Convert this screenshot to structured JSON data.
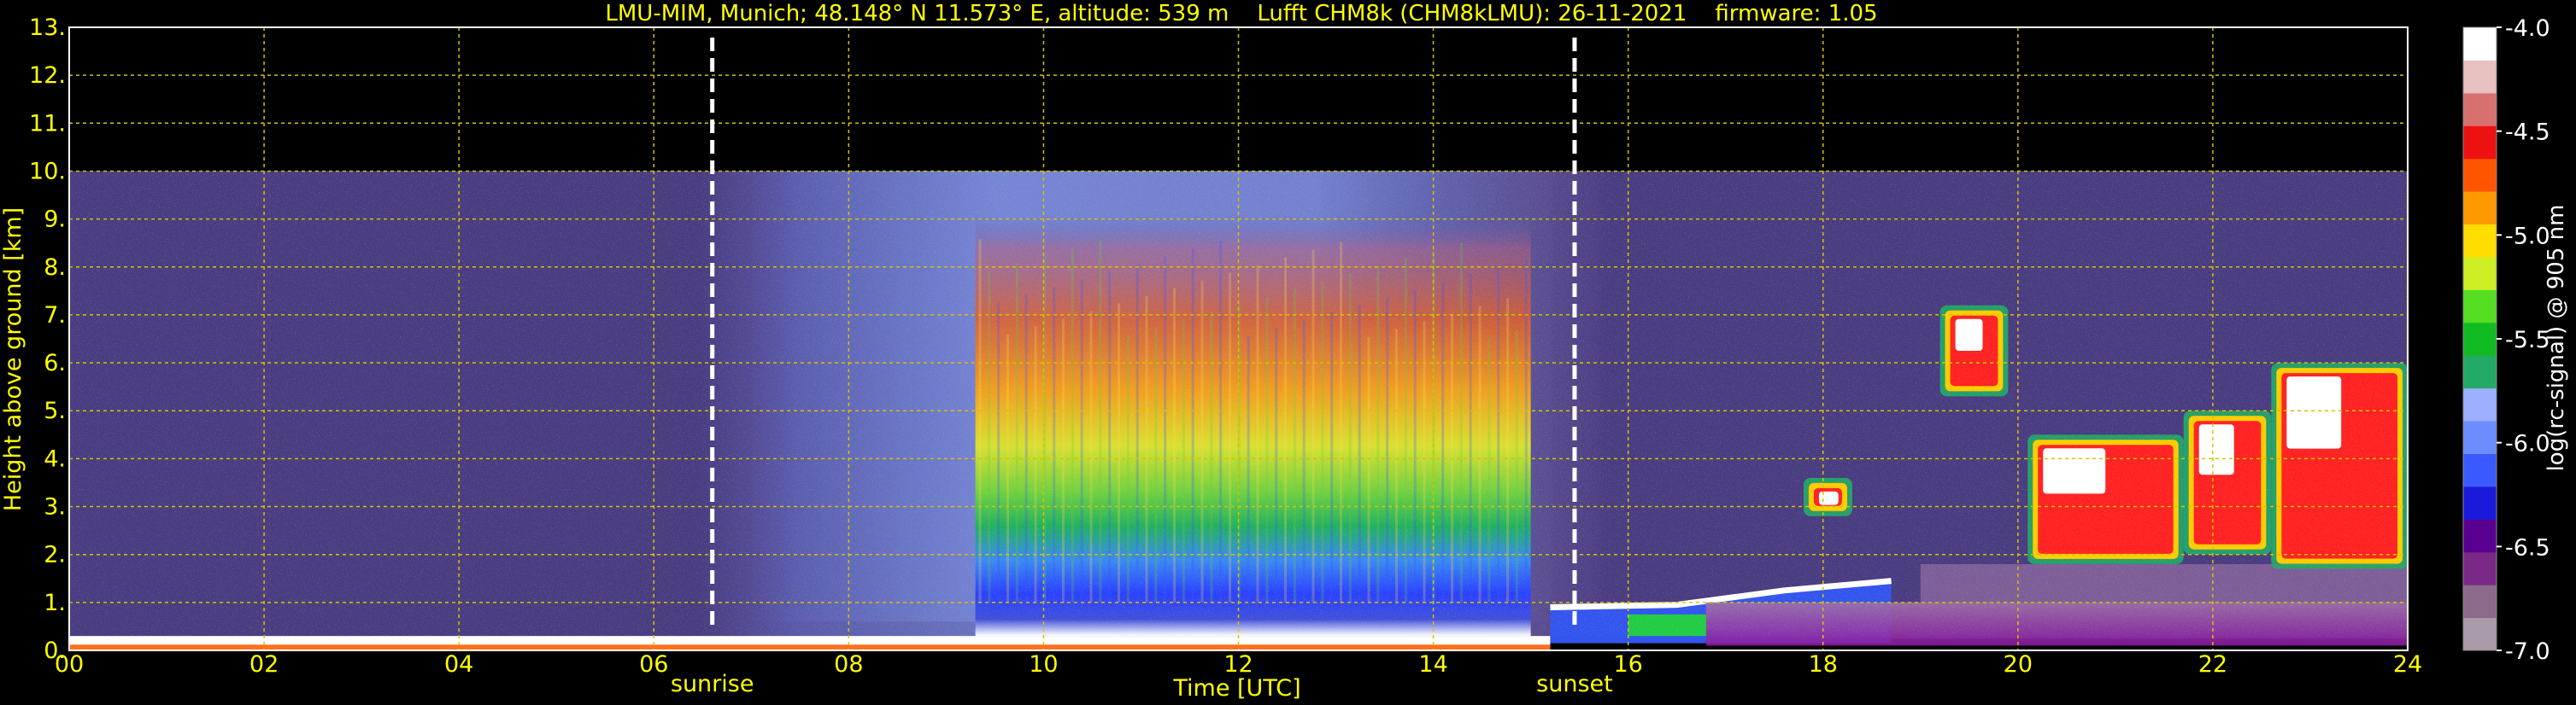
{
  "chart_data": {
    "type": "heatmap",
    "title": "LMU-MIM, Munich; 48.148° N 11.573° E, altitude: 539 m    Lufft CHM8k (CHM8kLMU): 26-11-2021    firmware: 1.05",
    "xlabel": "Time [UTC]",
    "ylabel": "Height above ground [km]",
    "colorbar_label": "log(rc-signal) @ 905 nm",
    "xlim": [
      0,
      24
    ],
    "ylim": [
      0,
      13
    ],
    "x_ticks": [
      "00",
      "02",
      "04",
      "06",
      "08",
      "10",
      "12",
      "14",
      "16",
      "18",
      "20",
      "22",
      "24"
    ],
    "y_ticks": [
      "0.",
      "1.",
      "2.",
      "3.",
      "4.",
      "5.",
      "6.",
      "7.",
      "8.",
      "9.",
      "10.",
      "11.",
      "12.",
      "13."
    ],
    "colorbar_range": [
      -7.0,
      -4.0
    ],
    "colorbar_ticks": [
      "-4.0",
      "-4.5",
      "-5.0",
      "-5.5",
      "-6.0",
      "-6.5",
      "-7.0"
    ],
    "colorbar_colors": [
      "#a89aa8",
      "#8c6a8c",
      "#7a2a86",
      "#5a0090",
      "#1a1adc",
      "#3a5aff",
      "#6c8cff",
      "#9cb0ff",
      "#22aa66",
      "#11bb22",
      "#55dd22",
      "#ccee22",
      "#ffdd00",
      "#ff9900",
      "#ff5500",
      "#ee1111",
      "#d97070",
      "#e8c0c0",
      "#ffffff"
    ],
    "grid": true,
    "grid_color": "#d4c400",
    "text_color": "#ffff00",
    "data_ceiling_km": 10,
    "events": [
      {
        "label": "sunrise",
        "time_utc": 6.6
      },
      {
        "label": "sunset",
        "time_utc": 15.45
      }
    ],
    "features": [
      {
        "name": "daytime-background",
        "t_start": 7.0,
        "t_end": 15.3
      },
      {
        "name": "boundary-layer",
        "t_start": 9.3,
        "t_end": 15.0,
        "height_km": 2.0
      },
      {
        "name": "surface-layer",
        "t_start": 0,
        "t_end": 24,
        "height_km": 0.3
      },
      {
        "name": "evening-cloud-band",
        "t_start": 15.2,
        "t_end": 18.7,
        "height_km": 1.3
      },
      {
        "name": "cloud-19-20h",
        "t_start": 19.0,
        "t_end": 20.0,
        "height_km": 6.5
      },
      {
        "name": "cloud-18h",
        "t_start": 17.8,
        "t_end": 18.3,
        "height_km": 3.5
      },
      {
        "name": "cloud-20-24h",
        "t_start": 20.1,
        "t_end": 24.0,
        "height_km": 4.0
      },
      {
        "name": "night-aerosol-layer",
        "t_start": 16.8,
        "t_end": 24.0,
        "height_km": 1.0
      }
    ]
  }
}
